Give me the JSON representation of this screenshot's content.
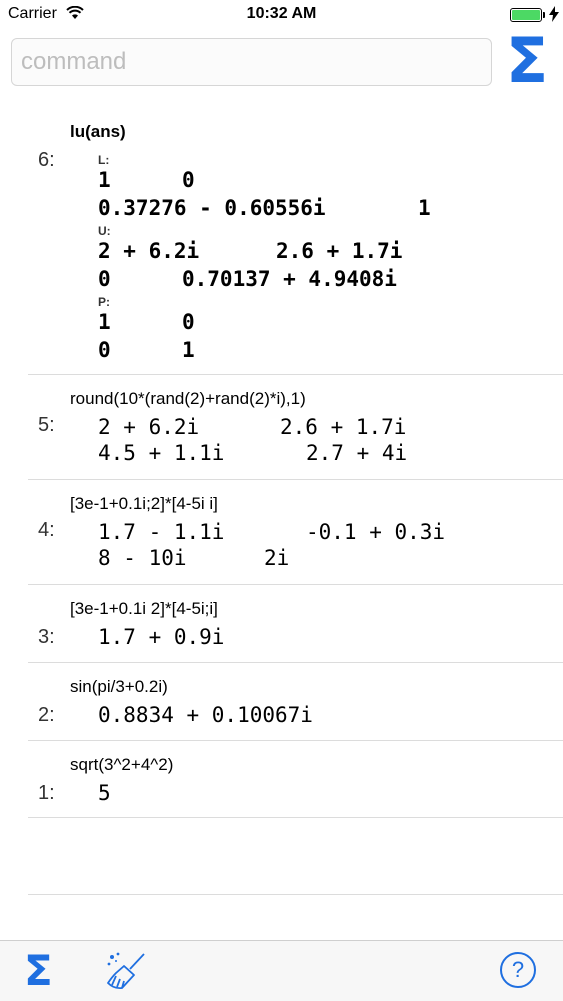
{
  "status": {
    "carrier": "Carrier",
    "time": "10:32 AM"
  },
  "command": {
    "placeholder": "command"
  },
  "history": [
    {
      "index": "6:",
      "command": "lu(ans)",
      "l_label": "L:",
      "l_rows": [
        [
          "1",
          "0"
        ],
        [
          "0.37276 - 0.60556i",
          "1"
        ]
      ],
      "u_label": "U:",
      "u_rows": [
        [
          "2 + 6.2i",
          "2.6 + 1.7i"
        ],
        [
          "0",
          "0.70137 + 4.9408i"
        ]
      ],
      "p_label": "P:",
      "p_rows": [
        [
          "1",
          "0"
        ],
        [
          "0",
          "1"
        ]
      ]
    },
    {
      "index": "5:",
      "command": "round(10*(rand(2)+rand(2)*i),1)",
      "rows": [
        [
          "2 + 6.2i",
          "2.6 + 1.7i"
        ],
        [
          "4.5 + 1.1i",
          "2.7 + 4i"
        ]
      ]
    },
    {
      "index": "4:",
      "command": "[3e-1+0.1i;2]*[4-5i i]",
      "rows": [
        [
          "1.7 - 1.1i",
          "-0.1 + 0.3i"
        ],
        [
          "8 - 10i",
          "2i"
        ]
      ]
    },
    {
      "index": "3:",
      "command": "[3e-1+0.1i 2]*[4-5i;i]",
      "result": "1.7 + 0.9i"
    },
    {
      "index": "2:",
      "command": "sin(pi/3+0.2i)",
      "result": "0.8834 + 0.10067i"
    },
    {
      "index": "1:",
      "command": "sqrt(3^2+4^2)",
      "result": "5"
    }
  ],
  "toolbar": {
    "sigma_glyph": "Σ",
    "help_glyph": "?"
  },
  "colors": {
    "accent": "#1f6fe0",
    "battery": "#4cd964"
  }
}
